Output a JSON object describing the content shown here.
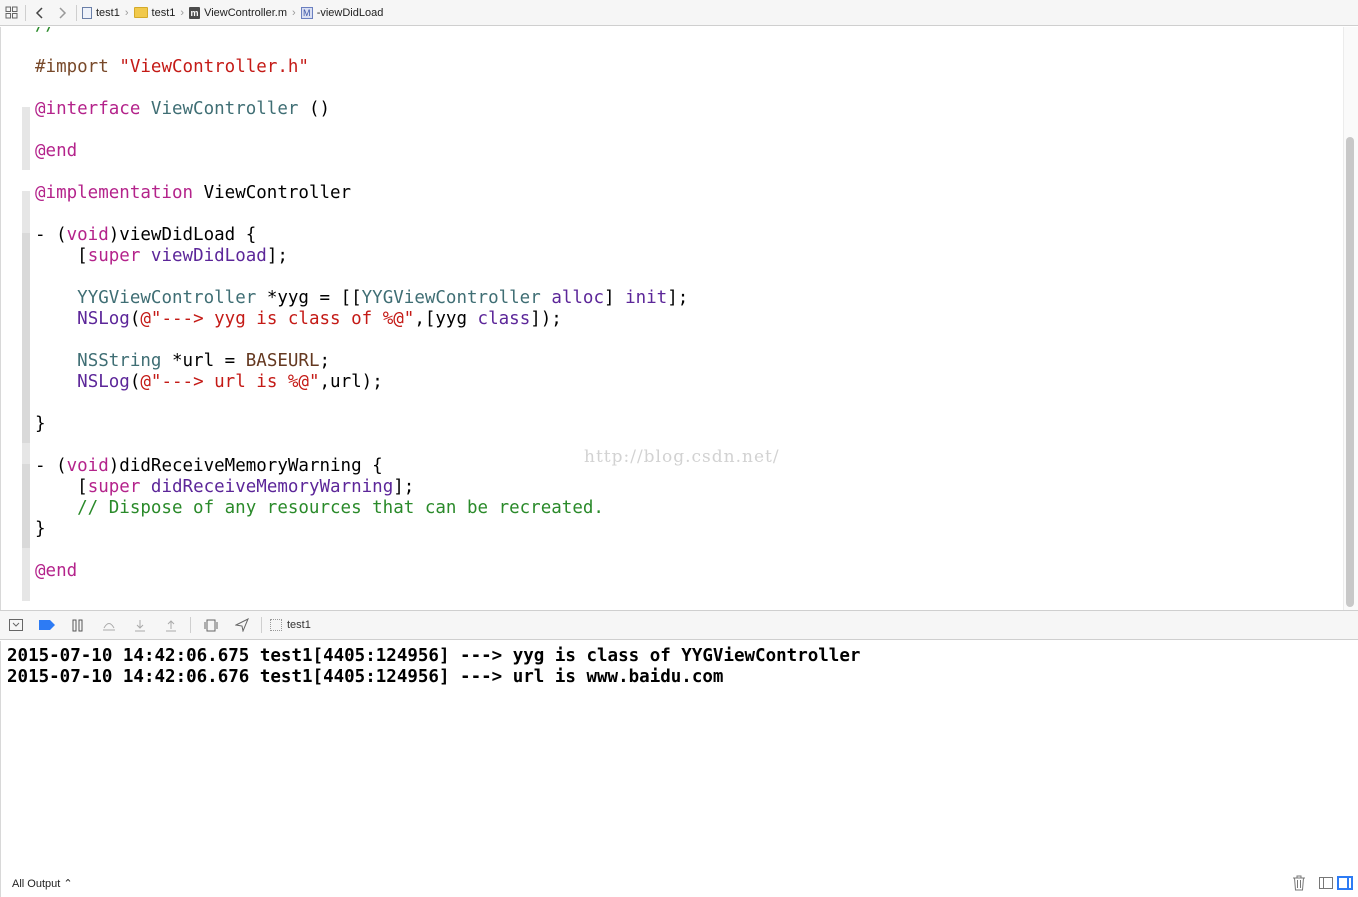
{
  "jumpbar": {
    "crumbs": [
      "test1",
      "test1",
      "ViewController.m",
      "-viewDidLoad"
    ],
    "method_badge": "M",
    "m_badge": "m"
  },
  "editor": {
    "lines": [
      "//",
      "",
      "#import \"ViewController.h\"",
      "",
      "@interface ViewController ()",
      "",
      "@end",
      "",
      "@implementation ViewController",
      "",
      "- (void)viewDidLoad {",
      "    [super viewDidLoad];",
      "",
      "    YYGViewController *yyg = [[YYGViewController alloc] init];",
      "    NSLog(@\"---> yyg is class of %@\",[yyg class]);",
      "",
      "    NSString *url = BASEURL;",
      "    NSLog(@\"---> url is %@\",url);",
      "",
      "}",
      "",
      "- (void)didReceiveMemoryWarning {",
      "    [super didReceiveMemoryWarning];",
      "    // Dispose of any resources that can be recreated.",
      "}",
      "",
      "@end"
    ],
    "watermark": "http://blog.csdn.net/"
  },
  "debugbar": {
    "target": "test1"
  },
  "console": {
    "lines": [
      "2015-07-10 14:42:06.675 test1[4405:124956] ---> yyg is class of YYGViewController",
      "2015-07-10 14:42:06.676 test1[4405:124956] ---> url is www.baidu.com"
    ]
  },
  "footer": {
    "filter": "All Output ⌃"
  },
  "colors": {
    "keyword": "#b4238b",
    "string": "#c41a16",
    "class": "#3f6e74",
    "comment": "#2a8a2a",
    "accent": "#2d7bf4"
  }
}
